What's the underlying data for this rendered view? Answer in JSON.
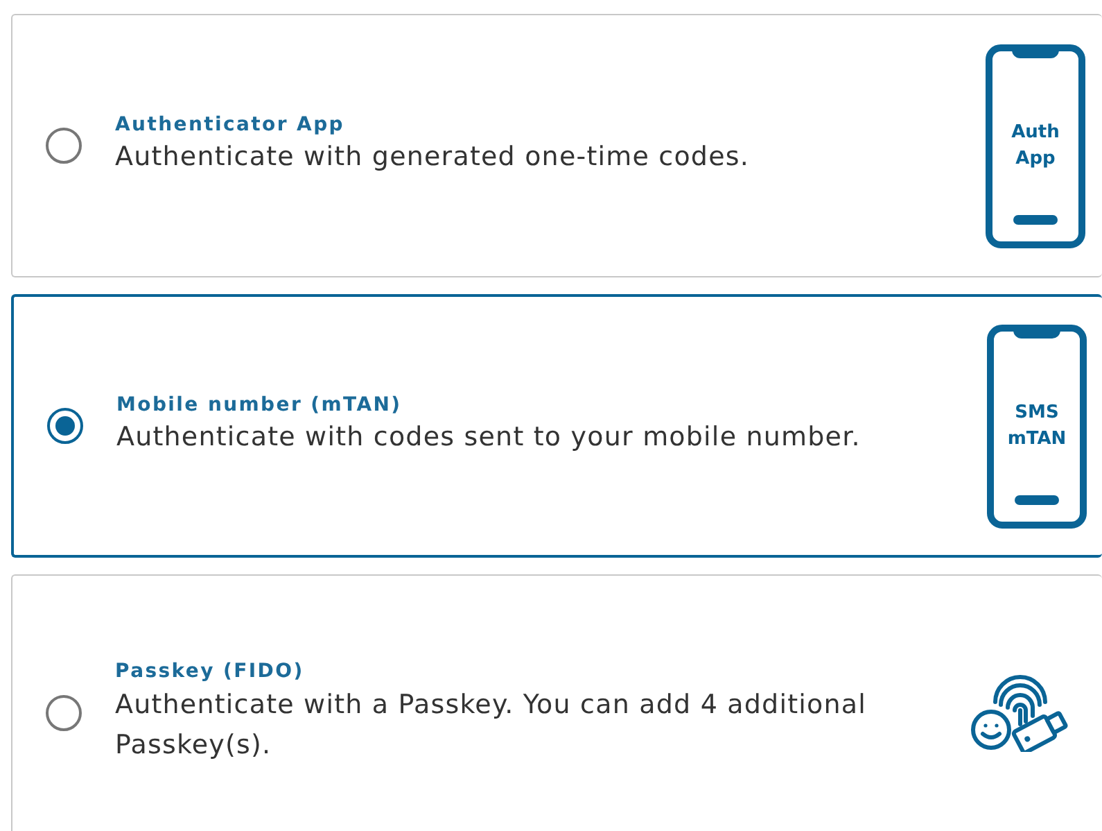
{
  "options": [
    {
      "title": "Authenticator App",
      "description": "Authenticate with generated one-time codes.",
      "selected": false,
      "icon": {
        "kind": "phone",
        "lines": [
          "Auth",
          "App"
        ]
      }
    },
    {
      "title": "Mobile number (mTAN)",
      "description": "Authenticate with codes sent to your mobile number.",
      "selected": true,
      "icon": {
        "kind": "phone",
        "lines": [
          "SMS",
          "mTAN"
        ]
      }
    },
    {
      "title": "Passkey (FIDO)",
      "description": "Authenticate with a Passkey. You can add 4 additional Passkey(s).",
      "selected": false,
      "icon": {
        "kind": "passkey"
      }
    }
  ]
}
